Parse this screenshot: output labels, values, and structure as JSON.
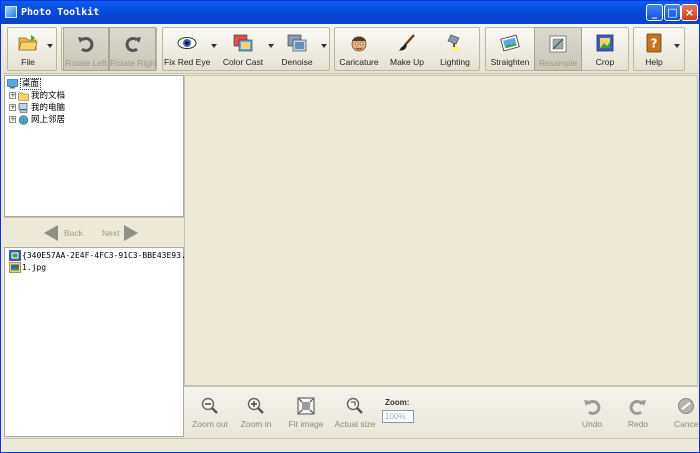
{
  "window": {
    "title": "Photo Toolkit",
    "minimize": "_",
    "maximize": "□",
    "close": "×"
  },
  "toolbar": {
    "file": "File",
    "rotate_left": "Rotate Left",
    "rotate_right": "Rotate Right",
    "fix_red_eye": "Fix Red Eye",
    "color_cast": "Color Cast",
    "denoise": "Denoise",
    "caricature": "Caricature",
    "make_up": "Make Up",
    "lighting": "Lighting",
    "straighten": "Straighten",
    "resample": "Resample",
    "crop": "Crop",
    "help": "Help"
  },
  "tree": {
    "root": "桌面",
    "items": [
      {
        "label": "我的文档",
        "icon": "folder-icon"
      },
      {
        "label": "我的电脑",
        "icon": "computer-icon"
      },
      {
        "label": "网上邻居",
        "icon": "network-icon"
      }
    ]
  },
  "nav": {
    "back": "Back",
    "next": "Next"
  },
  "files": [
    {
      "name": "{340E57AA-2E4F-4FC3-91C3-BBE43E93...",
      "icon": "film-icon"
    },
    {
      "name": "1.jpg",
      "icon": "image-icon"
    }
  ],
  "bottom": {
    "zoom_out": "Zoom out",
    "zoom_in": "Zoom in",
    "fit_image": "Fit image",
    "actual_size": "Actual size",
    "zoom_label": "Zoom:",
    "zoom_value": "100%",
    "undo": "Undo",
    "redo": "Redo",
    "cancel": "Cancel"
  },
  "colors": {
    "titlebar": "#0a5ef0",
    "panel": "#ece9d8",
    "accent": "#0831d9"
  }
}
